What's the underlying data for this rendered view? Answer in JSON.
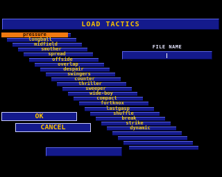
{
  "window": {
    "title": "LOAD TACTICS"
  },
  "file_name": {
    "label": "FILE NAME",
    "value": ""
  },
  "tactics": {
    "selected_index": 0,
    "items": [
      "pressure",
      "longball",
      "midfield",
      "smother",
      "spread",
      "offside",
      "overlap",
      "despair",
      "swingers",
      "counter",
      "thriller",
      "sweeper",
      "wide-boy",
      "compact",
      "fortknox",
      "lastgasp",
      "shuffle",
      "break",
      "strike",
      "dynamic"
    ]
  },
  "buttons": {
    "ok": "OK",
    "cancel": "CANCEL"
  },
  "colors": {
    "background": "#000000",
    "panel": "#141a8c",
    "text": "#f6c000",
    "highlight": "#f07a10"
  }
}
